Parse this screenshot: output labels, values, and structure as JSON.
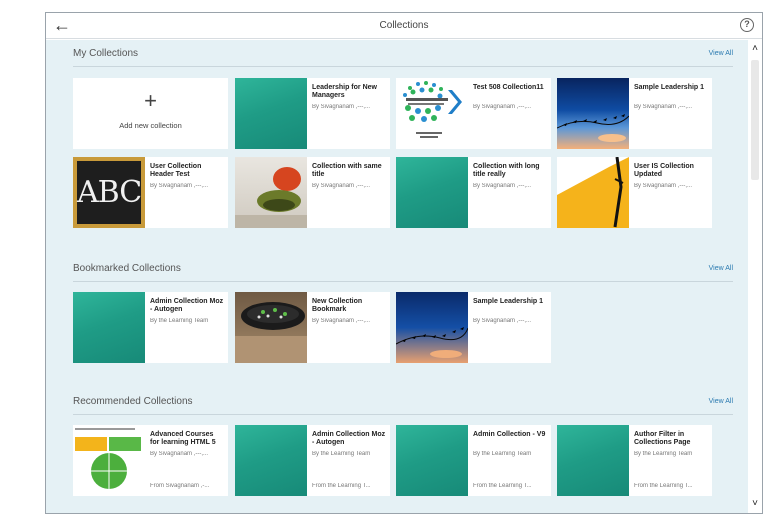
{
  "window": {
    "title": "Collections"
  },
  "icons": {
    "back": "back-arrow-icon",
    "help": "help-icon"
  },
  "sections": {
    "my": {
      "title": "My Collections",
      "view_all": "View All",
      "add_label": "Add new collection",
      "cards": [
        {
          "name": "Leadership for New Managers",
          "author": "By Sivagnanam ,---,..."
        },
        {
          "name": "Test 508 Collection11",
          "author": "By Sivagnanam ,---,..."
        },
        {
          "name": "Sample Leadership 1",
          "author": "By Sivagnanam ,---,..."
        },
        {
          "name": "User Collection Header Test",
          "author": "By Sivagnanam ,---,..."
        },
        {
          "name": "Collection with same title",
          "author": "By Sivagnanam ,---,..."
        },
        {
          "name": "Collection with long title really",
          "author": "By Sivagnanam ,---,..."
        },
        {
          "name": "User IS Collection Updated",
          "author": "By Sivagnanam ,---,..."
        }
      ]
    },
    "bookmarked": {
      "title": "Bookmarked Collections",
      "view_all": "View All",
      "cards": [
        {
          "name": "Admin Collection Moz - Autogen",
          "author": "By the Learning Team"
        },
        {
          "name": "New Collection Bookmark",
          "author": "By Sivagnanam ,---,..."
        },
        {
          "name": "Sample Leadership 1",
          "author": "By Sivagnanam ,---,..."
        }
      ]
    },
    "recommended": {
      "title": "Recommended Collections",
      "view_all": "View All",
      "cards": [
        {
          "name": "Advanced Courses for learning HTML 5",
          "author": "By Sivagnanam ,---,...",
          "from": "From Sivagnanam ,-..."
        },
        {
          "name": "Admin Collection Moz - Autogen",
          "author": "By the Learning Team",
          "from": "From the Learning T..."
        },
        {
          "name": "Admin Collection - V9",
          "author": "By the Learning Team",
          "from": "From the Learning T..."
        },
        {
          "name": "Author Filter in Collections Page",
          "author": "By the Learning Team",
          "from": "From the Learning T..."
        }
      ]
    }
  },
  "thumb_text": {
    "abc": "ABC"
  }
}
